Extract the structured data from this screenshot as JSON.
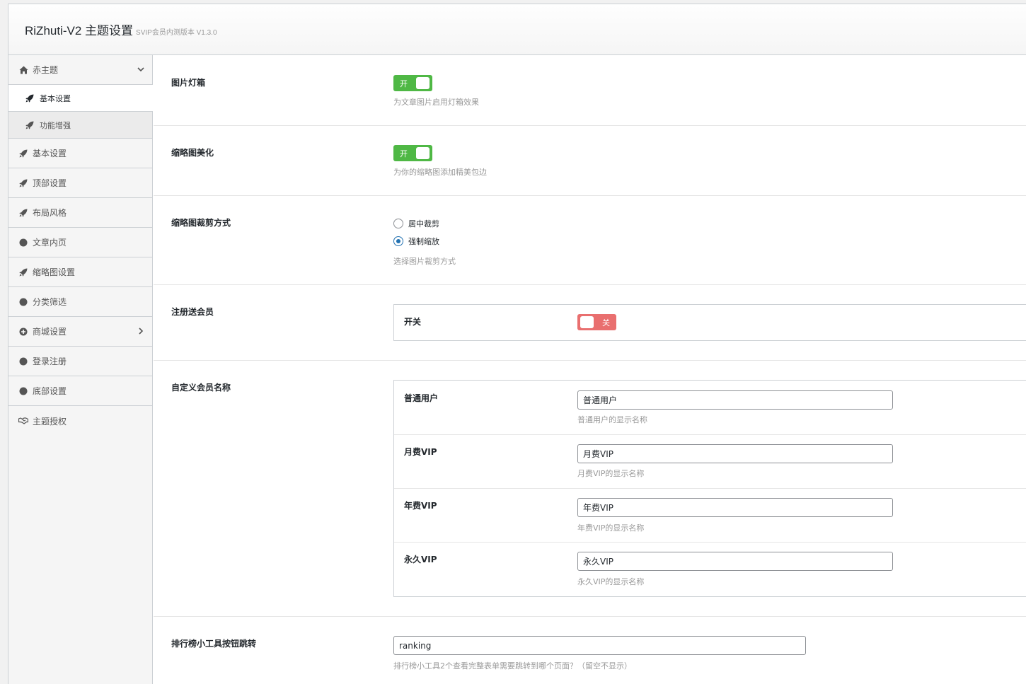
{
  "header": {
    "title": "RiZhuti-V2 主题设置",
    "version": "SVIP会员内测版本 V1.3.0"
  },
  "sidebar": {
    "items": [
      {
        "label": "赤主题",
        "icon": "home-icon",
        "expanded": true,
        "children": [
          {
            "label": "基本设置",
            "icon": "rocket-icon",
            "active": true
          },
          {
            "label": "功能增强",
            "icon": "rocket-icon",
            "active": false
          }
        ]
      },
      {
        "label": "基本设置",
        "icon": "rocket-icon"
      },
      {
        "label": "顶部设置",
        "icon": "rocket-icon"
      },
      {
        "label": "布局风格",
        "icon": "rocket-icon"
      },
      {
        "label": "文章内页",
        "icon": "circle-icon"
      },
      {
        "label": "缩略图设置",
        "icon": "rocket-icon"
      },
      {
        "label": "分类筛选",
        "icon": "circle-icon"
      },
      {
        "label": "商城设置",
        "icon": "plus-circle-icon"
      },
      {
        "label": "登录注册",
        "icon": "circle-icon"
      },
      {
        "label": "底部设置",
        "icon": "circle-icon"
      },
      {
        "label": "主题授权",
        "icon": "handshake-icon"
      }
    ]
  },
  "fields": {
    "lightbox": {
      "label": "图片灯箱",
      "switch_label": "开",
      "desc": "为文章图片启用灯箱效果"
    },
    "thumb_beautify": {
      "label": "缩略图美化",
      "switch_label": "开",
      "desc": "为你的缩略图添加精美包边"
    },
    "thumb_crop": {
      "label": "缩略图裁剪方式",
      "options": [
        "居中裁剪",
        "强制缩放"
      ],
      "selected": "强制缩放",
      "desc": "选择图片裁剪方式"
    },
    "register_vip": {
      "label": "注册送会员",
      "sub_label": "开关",
      "switch_label": "关"
    },
    "vip_names": {
      "label": "自定义会员名称",
      "rows": [
        {
          "label": "普通用户",
          "value": "普通用户",
          "desc": "普通用户的显示名称"
        },
        {
          "label": "月费VIP",
          "value": "月费VIP",
          "desc": "月费VIP的显示名称"
        },
        {
          "label": "年费VIP",
          "value": "年费VIP",
          "desc": "年费VIP的显示名称"
        },
        {
          "label": "永久VIP",
          "value": "永久VIP",
          "desc": "永久VIP的显示名称"
        }
      ]
    },
    "ranking": {
      "label": "排行榜小工具按钮跳转",
      "value": "ranking",
      "desc": "排行榜小工具2个查看完整表单需要跳转到哪个页面？（留空不显示）"
    }
  }
}
